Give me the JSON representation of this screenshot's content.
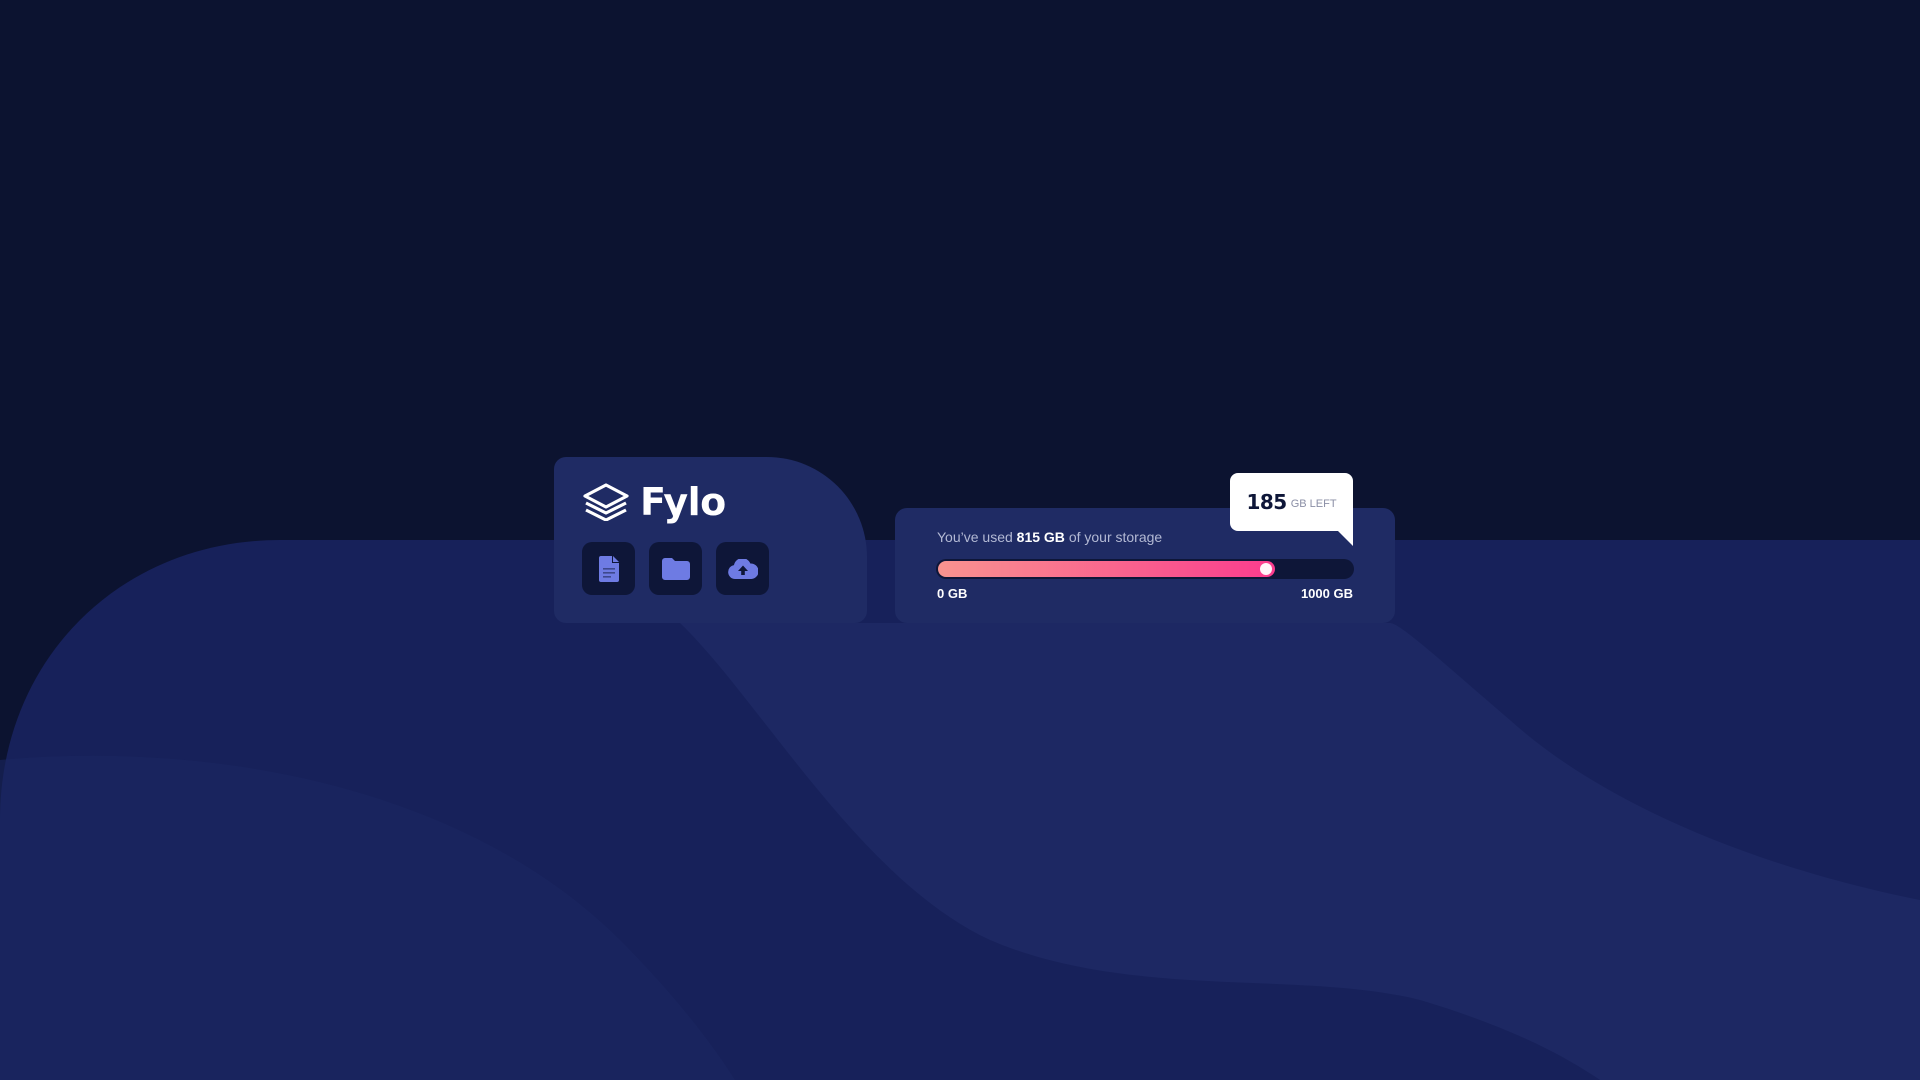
{
  "app": {
    "name": "Fylo"
  },
  "toolbar": {
    "icons": [
      "document-icon",
      "folder-icon",
      "cloud-upload-icon"
    ]
  },
  "storage": {
    "usage_prefix": "You’ve used",
    "used": "815 GB",
    "usage_suffix": "of your storage",
    "min_label": "0 GB",
    "max_label": "1000 GB",
    "used_fraction": 0.815,
    "remaining": "185",
    "remaining_unit": "GB LEFT"
  },
  "colors": {
    "background": "#0c1330",
    "card": "#1f2b64",
    "bar_track": "#0e1638",
    "bar_gradient_start": "#f8938f",
    "bar_gradient_end": "#fb3c8e",
    "icon_accent": "#6e7be3"
  }
}
